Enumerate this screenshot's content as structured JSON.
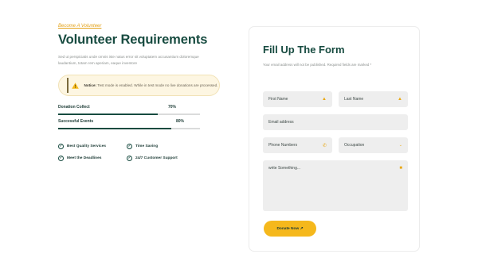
{
  "left": {
    "eyebrow": "Become A Volunteer",
    "title": "Volunteer Requirements",
    "description": "Sed ut perspiciatis unde omnis iste natus error sit voluptatem accusantium doloremque laudantium, totam rem aperiam, eaque inventore",
    "notice": {
      "label": "Notice:",
      "text": "Test mode is enabled. While in test mode no live donations are processed.",
      "icon": "warning-icon"
    },
    "progress": [
      {
        "label": "Donation Collect",
        "percent_label": "70%",
        "value": 0.7
      },
      {
        "label": "Successful Events",
        "percent_label": "80%",
        "value": 0.8
      }
    ],
    "features": [
      "Best Quality Services",
      "Time Saving",
      "Meet the Deadlines",
      "24/7 Customer Support"
    ]
  },
  "form": {
    "title": "Fill Up The Form",
    "note": "Your email address will not be published. Required fields are marked *",
    "first_name": "First Name",
    "last_name": "Last Name",
    "email": "Email address",
    "phone": "Phone Numbers",
    "occupation": "Occupation",
    "message": "write Something...",
    "submit": "Donate Now ↗"
  },
  "colors": {
    "brand": "#174b40",
    "accent": "#f5b81c",
    "field_bg": "#eeeeee"
  }
}
